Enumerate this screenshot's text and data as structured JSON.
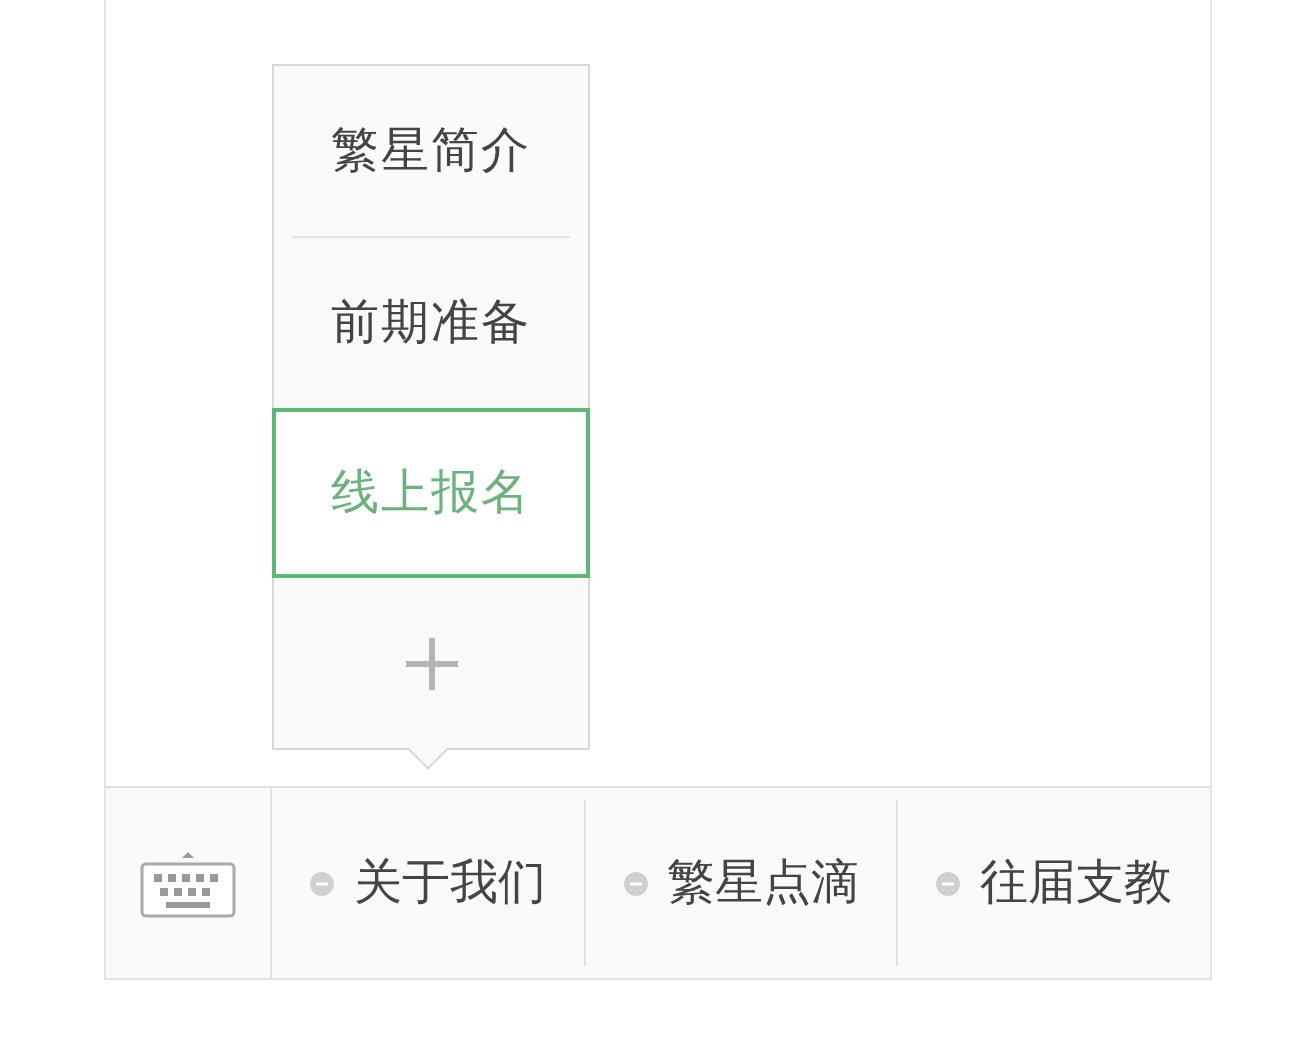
{
  "submenu": [
    {
      "label": "繁星简介",
      "selected": false
    },
    {
      "label": "前期准备",
      "selected": false
    },
    {
      "label": "线上报名",
      "selected": true
    }
  ],
  "menu": [
    {
      "label": "关于我们"
    },
    {
      "label": "繁星点滴"
    },
    {
      "label": "往届支教"
    }
  ]
}
